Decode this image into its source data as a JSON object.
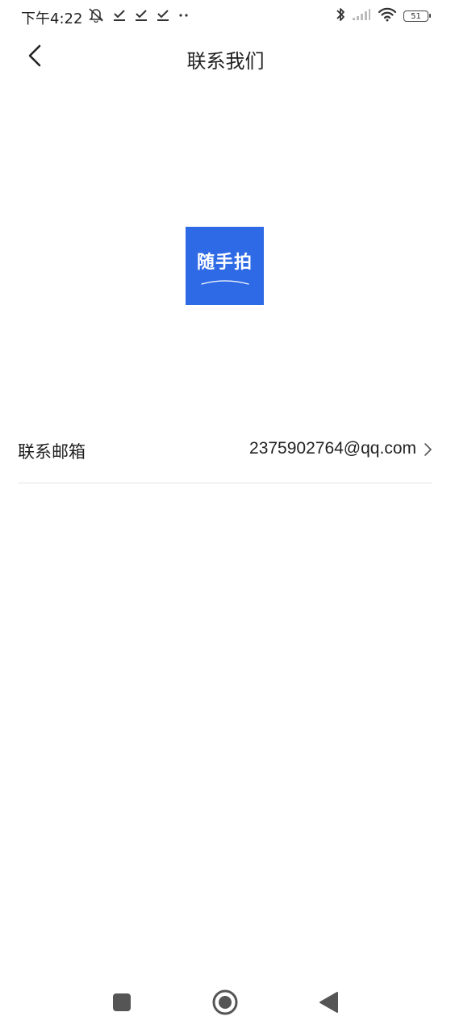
{
  "status_bar": {
    "time": "下午4:22",
    "left_icons": [
      "bell-off-icon",
      "download-done-icon",
      "download-done-icon",
      "download-done-icon",
      "more-dots-icon"
    ],
    "right_icons": [
      "bluetooth-icon",
      "signal-icon",
      "wifi-icon",
      "battery-icon"
    ],
    "battery_level": "51"
  },
  "header": {
    "title": "联系我们",
    "back_icon": "chevron-left-icon"
  },
  "logo": {
    "text": "随手拍",
    "background": "#2f6ae6"
  },
  "contact": {
    "label": "联系邮箱",
    "value": "2375902764@qq.com",
    "chevron_icon": "chevron-right-icon"
  },
  "nav_bar": {
    "buttons": [
      "recents-square-icon",
      "home-circle-icon",
      "back-triangle-icon"
    ]
  }
}
